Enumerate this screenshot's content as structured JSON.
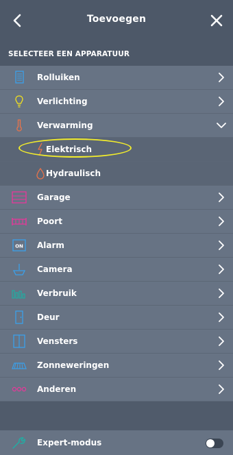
{
  "header": {
    "title": "Toevoegen",
    "back_icon": "chevron-left-icon",
    "close_icon": "close-icon"
  },
  "section": {
    "title": "SELECTEER EEN APPARATUUR"
  },
  "items": [
    {
      "label": "Rolluiken",
      "icon": "shutter-icon",
      "color": "#3aa0ea",
      "state": "collapsed"
    },
    {
      "label": "Verlichting",
      "icon": "bulb-icon",
      "color": "#f4e21c",
      "state": "collapsed"
    },
    {
      "label": "Verwarming",
      "icon": "thermometer-icon",
      "color": "#e8734a",
      "state": "expanded"
    },
    {
      "label": "Elektrisch",
      "icon": "lightning-icon",
      "color": "#e8734a",
      "sub": true
    },
    {
      "label": "Hydraulisch",
      "icon": "drop-icon",
      "color": "#e8734a",
      "sub": true
    },
    {
      "label": "Garage",
      "icon": "garage-icon",
      "color": "#e8379a",
      "state": "collapsed"
    },
    {
      "label": "Poort",
      "icon": "gate-icon",
      "color": "#e8379a",
      "state": "collapsed"
    },
    {
      "label": "Alarm",
      "icon": "alarm-icon",
      "color": "#3aa0ea",
      "state": "collapsed",
      "icon_text": "ON"
    },
    {
      "label": "Camera",
      "icon": "camera-icon",
      "color": "#3aa0ea",
      "state": "collapsed"
    },
    {
      "label": "Verbruik",
      "icon": "consumption-icon",
      "color": "#1bb2a6",
      "state": "collapsed"
    },
    {
      "label": "Deur",
      "icon": "door-icon",
      "color": "#3aa0ea",
      "state": "collapsed"
    },
    {
      "label": "Vensters",
      "icon": "window-icon",
      "color": "#3aa0ea",
      "state": "collapsed"
    },
    {
      "label": "Zonneweringen",
      "icon": "awning-icon",
      "color": "#3aa0ea",
      "state": "collapsed"
    },
    {
      "label": "Anderen",
      "icon": "dots-icon",
      "color": "#e8379a",
      "state": "collapsed"
    }
  ],
  "footer": {
    "label": "Expert-modus",
    "icon": "wrench-icon",
    "toggle_on": false
  }
}
